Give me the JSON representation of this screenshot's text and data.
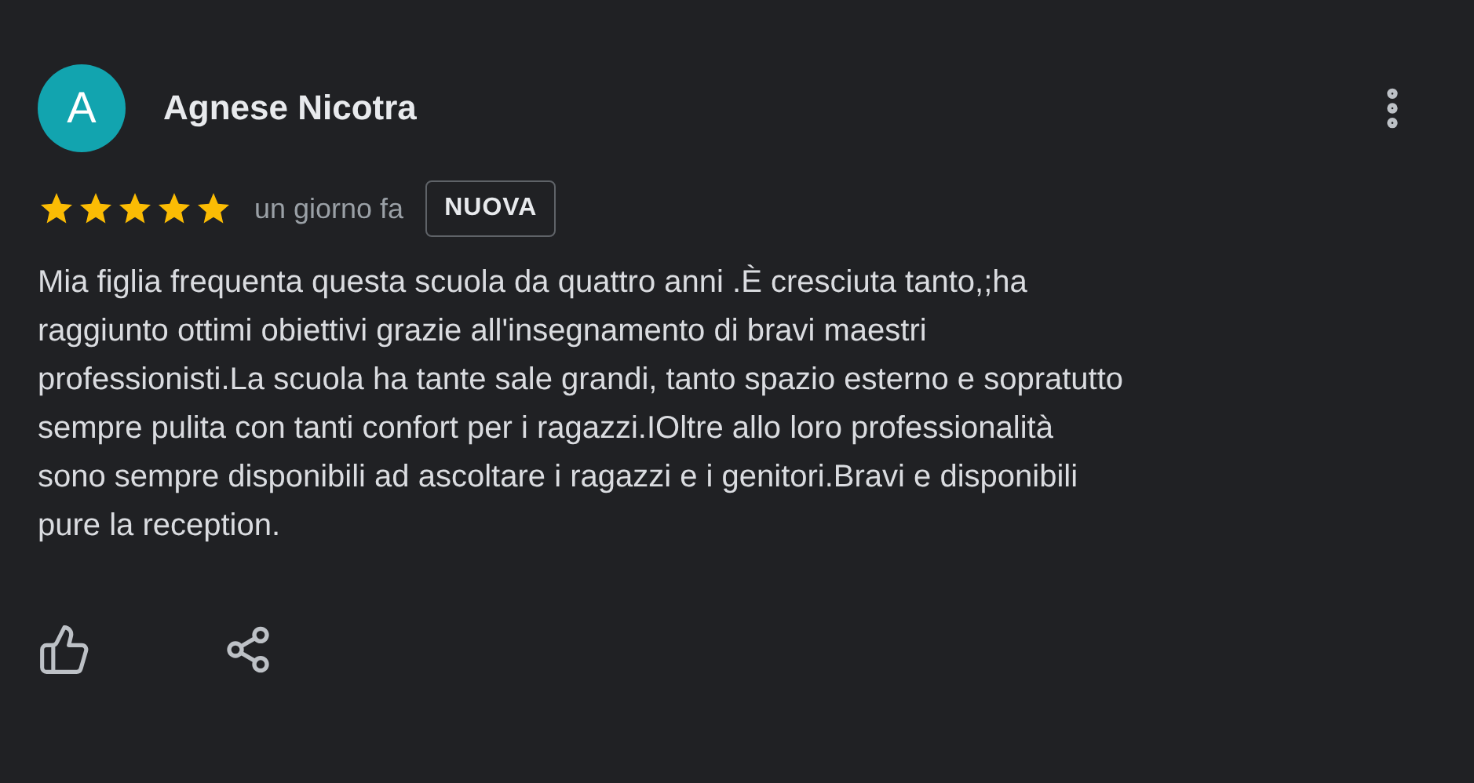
{
  "review": {
    "avatar_letter": "A",
    "author": "Agnese Nicotra",
    "stars": 5,
    "time": "un giorno fa",
    "badge": "NUOVA",
    "text": "Mia figlia frequenta questa scuola da quattro anni .È cresciuta tanto,;ha\nraggiunto ottimi obiettivi grazie all'insegnamento di bravi maestri\nprofessionisti.La scuola ha tante sale grandi, tanto spazio esterno e sopratutto\nsempre pulita con tanti confort per i ragazzi.IOltre allo loro professionalità\nsono sempre disponibili ad ascoltare i ragazzi e i genitori.Bravi e disponibili\npure la reception."
  }
}
